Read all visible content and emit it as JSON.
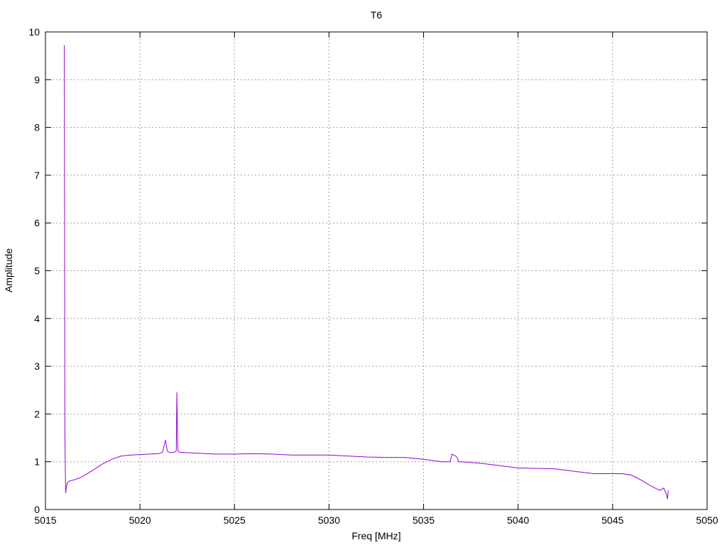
{
  "chart_data": {
    "type": "line",
    "title": "T6",
    "xlabel": "Freq [MHz]",
    "ylabel": "Amplitude",
    "xlim": [
      5015,
      5050
    ],
    "ylim": [
      0,
      10
    ],
    "x_ticks": [
      "5015",
      "5020",
      "5025",
      "5030",
      "5035",
      "5040",
      "5045",
      "5050"
    ],
    "y_ticks": [
      "0",
      "1",
      "2",
      "3",
      "4",
      "5",
      "6",
      "7",
      "8",
      "9",
      "10"
    ],
    "grid": true,
    "legend": "none",
    "series": [
      {
        "color": "#9400d3",
        "x": [
          5016.0,
          5016.03,
          5016.05,
          5016.07,
          5016.1,
          5016.15,
          5016.2,
          5016.3,
          5016.5,
          5016.8,
          5017.0,
          5017.5,
          5018.0,
          5018.5,
          5019.0,
          5019.5,
          5020.0,
          5020.5,
          5021.0,
          5021.2,
          5021.3,
          5021.35,
          5021.45,
          5021.6,
          5021.8,
          5021.92,
          5021.95,
          5021.97,
          5022.0,
          5022.03,
          5022.1,
          5022.5,
          5023.0,
          5024.0,
          5025.0,
          5026.0,
          5027.0,
          5028.0,
          5029.0,
          5030.0,
          5031.0,
          5032.0,
          5033.0,
          5034.0,
          5035.0,
          5036.0,
          5036.4,
          5036.5,
          5036.7,
          5036.8,
          5036.85,
          5037.0,
          5038.0,
          5039.0,
          5040.0,
          5041.0,
          5042.0,
          5043.0,
          5044.0,
          5045.0,
          5045.5,
          5046.0,
          5046.5,
          5047.0,
          5047.3,
          5047.5,
          5047.7,
          5047.85,
          5047.9,
          5047.95
        ],
        "y": [
          9.72,
          1.6,
          0.85,
          0.35,
          0.45,
          0.55,
          0.58,
          0.6,
          0.62,
          0.66,
          0.7,
          0.82,
          0.95,
          1.05,
          1.12,
          1.14,
          1.15,
          1.16,
          1.17,
          1.2,
          1.38,
          1.45,
          1.22,
          1.19,
          1.2,
          1.23,
          2.45,
          1.9,
          1.3,
          1.22,
          1.2,
          1.19,
          1.18,
          1.16,
          1.16,
          1.17,
          1.16,
          1.14,
          1.14,
          1.14,
          1.12,
          1.1,
          1.09,
          1.09,
          1.05,
          1.0,
          1.0,
          1.16,
          1.12,
          1.08,
          1.0,
          1.0,
          0.97,
          0.92,
          0.87,
          0.86,
          0.85,
          0.8,
          0.75,
          0.75,
          0.75,
          0.72,
          0.62,
          0.5,
          0.44,
          0.4,
          0.45,
          0.32,
          0.22,
          0.4
        ]
      }
    ]
  }
}
